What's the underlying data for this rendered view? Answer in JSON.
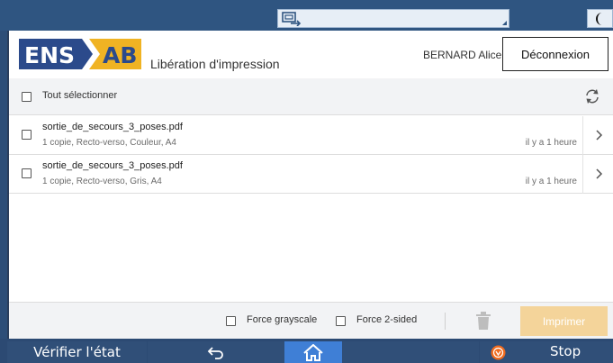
{
  "device": {
    "status_button": "Vérifier l'état",
    "stop_button": "Stop"
  },
  "header": {
    "logo_left": "ENS",
    "logo_right": "AB",
    "title": "Libération d'impression",
    "user": "BERNARD Alice",
    "logout": "Déconnexion"
  },
  "select_all": "Tout sélectionner",
  "jobs": [
    {
      "name": "sortie_de_secours_3_poses.pdf",
      "details": "1 copie, Recto-verso, Couleur, A4",
      "time": "il y a 1 heure"
    },
    {
      "name": "sortie_de_secours_3_poses.pdf",
      "details": "1 copie, Recto-verso, Gris, A4",
      "time": "il y a 1 heure"
    }
  ],
  "footer": {
    "force_grayscale": "Force grayscale",
    "force_2sided": "Force 2-sided",
    "print": "Imprimer"
  },
  "colors": {
    "brand_blue": "#2b4a8b",
    "brand_gold": "#f0b323",
    "print_button": "#f4d49a",
    "home_active": "#3f7fd6"
  }
}
